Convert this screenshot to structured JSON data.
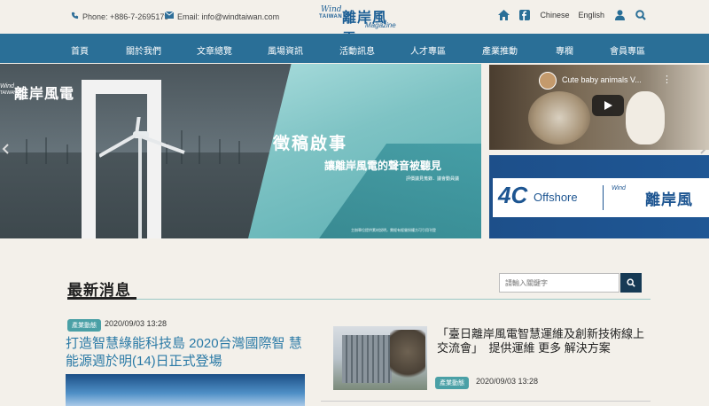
{
  "topbar": {
    "phone_label": "Phone: +886-7-2695179",
    "email_label": "Email: info@windtaiwan.com",
    "lang_chinese": "Chinese",
    "lang_english": "English"
  },
  "logo": {
    "wind": "Wind",
    "taiwan": "TAIWAN",
    "chinese": "離岸風電",
    "magazine": "Magazine"
  },
  "nav": {
    "items": [
      "首頁",
      "關於我們",
      "文章總覽",
      "風場資訊",
      "活動訊息",
      "人才專區",
      "產業推動",
      "專欄",
      "會員專區"
    ]
  },
  "hero": {
    "logo_chinese": "離岸風電",
    "logo_wind": "Wind",
    "logo_taiwan": "TAIWAN",
    "headline": "徵稿啟事",
    "subheadline": "讓離岸風電的聲音被聽見",
    "sub2": "評價議見蒐錄．議會動員議",
    "fine": "主辦單位提供素材說明，需經有經營授權方可引用刊登"
  },
  "video": {
    "title": "Cute baby animals V..."
  },
  "banner": {
    "four": "4C",
    "offshore": "Offshore",
    "wind": "Wind",
    "chinese": "離岸風"
  },
  "news": {
    "section_title": "最新消息",
    "search_placeholder": "請輸入關鍵字",
    "items": [
      {
        "badge": "產業動態",
        "date": "2020/09/03 13:28",
        "title": "打造智慧綠能科技島 2020台灣國際智 慧能源週於明(14)日正式登場"
      },
      {
        "badge": "產業動態",
        "date": "2020/09/03 13:28",
        "title": "「臺日離岸風電智慧運維及創新技術線上交流會」　提供運維 更多 解決方案"
      }
    ]
  },
  "colors": {
    "nav_bg": "#2a6f97",
    "accent": "#4aa0a6",
    "link": "#2b7aa6",
    "search_button": "#163a55"
  }
}
